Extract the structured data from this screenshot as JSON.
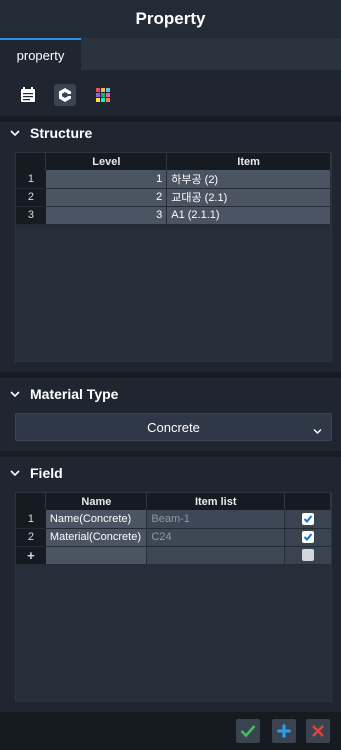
{
  "window": {
    "title": "Property"
  },
  "tabs": [
    {
      "label": "property",
      "active": true
    }
  ],
  "toolbar": {
    "tools": [
      {
        "icon": "calendar-icon",
        "active": false
      },
      {
        "icon": "cube-icon",
        "active": true
      },
      {
        "icon": "color-grid-icon",
        "active": false
      }
    ]
  },
  "structure": {
    "title": "Structure",
    "columns": [
      "Level",
      "Item"
    ],
    "rows": [
      {
        "num": "1",
        "level": "1",
        "item": "하부공 (2)"
      },
      {
        "num": "2",
        "level": "2",
        "item": "교대공 (2.1)"
      },
      {
        "num": "3",
        "level": "3",
        "item": "A1 (2.1.1)"
      }
    ]
  },
  "material": {
    "title": "Material Type",
    "selected": "Concrete"
  },
  "field": {
    "title": "Field",
    "columns": [
      "Name",
      "Item list",
      ""
    ],
    "rows": [
      {
        "num": "1",
        "name": "Name(Concrete)",
        "item_list": "Beam-1",
        "checked": true
      },
      {
        "num": "2",
        "name": "Material(Concrete)",
        "item_list": "C24",
        "checked": true
      }
    ],
    "new_row_marker": "+"
  },
  "footer": {
    "buttons": [
      {
        "icon": "check-icon",
        "color": "#3cc35a"
      },
      {
        "icon": "plus-icon",
        "color": "#2f9cf0"
      },
      {
        "icon": "close-icon",
        "color": "#e5413a"
      }
    ]
  },
  "colors": {
    "accent": "#2f8fe6",
    "background": "#1f2630",
    "header": "#161b22"
  }
}
